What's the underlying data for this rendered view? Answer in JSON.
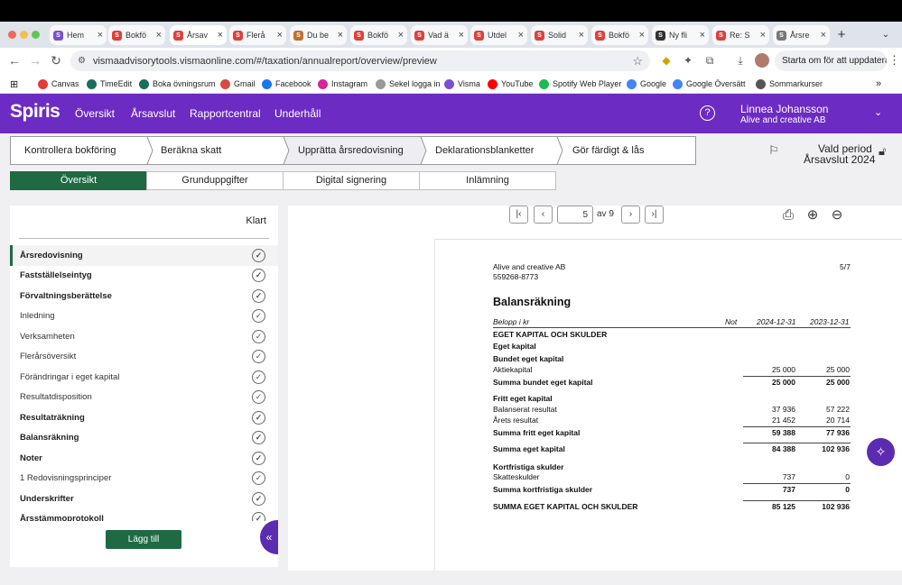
{
  "browser": {
    "tabs": [
      {
        "label": "Hem",
        "icon": "canvas-favicon",
        "color": "#7b4fd0"
      },
      {
        "label": "Bokfö",
        "icon": "spiris-favicon",
        "color": "#e0403a"
      },
      {
        "label": "Årsav",
        "icon": "spiris-favicon",
        "color": "#e0403a"
      },
      {
        "label": "Flerå",
        "icon": "spiris-favicon",
        "color": "#e0403a"
      },
      {
        "label": "Du be",
        "icon": "globe-favicon",
        "color": "#c0702f"
      },
      {
        "label": "Bokfö",
        "icon": "spiris-favicon",
        "color": "#e0403a"
      },
      {
        "label": "Vad ä",
        "icon": "spiris-favicon",
        "color": "#e0403a"
      },
      {
        "label": "Utdel",
        "icon": "spiris-favicon",
        "color": "#e0403a"
      },
      {
        "label": "Solid",
        "icon": "spiris-favicon",
        "color": "#e0403a"
      },
      {
        "label": "Bokfö",
        "icon": "spiris-favicon",
        "color": "#e0403a"
      },
      {
        "label": "Ny fli",
        "icon": "github-favicon",
        "color": "#333333"
      },
      {
        "label": "Re: S",
        "icon": "spiris-favicon",
        "color": "#e0403a"
      },
      {
        "label": "Årsre",
        "icon": "globe-favicon",
        "color": "#777777"
      }
    ],
    "url": "vismaadvisorytools.vismaonline.com/#/taxation/annualreport/overview/preview",
    "update_label": "Starta om för att uppdatera",
    "bookmarks": [
      {
        "label": "Canvas",
        "icon": "canvas-icon",
        "color": "#e23b3b"
      },
      {
        "label": "TimeEdit",
        "icon": "timeedit-icon",
        "color": "#1a6e5a"
      },
      {
        "label": "Boka övningsrum",
        "icon": "timeedit-icon",
        "color": "#1a6e5a"
      },
      {
        "label": "Gmail",
        "icon": "gmail-icon",
        "color": "#d54b3d"
      },
      {
        "label": "Facebook",
        "icon": "facebook-icon",
        "color": "#1877f2"
      },
      {
        "label": "Instagram",
        "icon": "instagram-icon",
        "color": "#d6249f"
      },
      {
        "label": "Sekel logga in",
        "icon": "sekel-icon",
        "color": "#999999"
      },
      {
        "label": "Visma",
        "icon": "visma-icon",
        "color": "#7b4fd0"
      },
      {
        "label": "YouTube",
        "icon": "youtube-icon",
        "color": "#ff0000"
      },
      {
        "label": "Spotify Web Player",
        "icon": "spotify-icon",
        "color": "#1db954"
      },
      {
        "label": "Google",
        "icon": "google-icon",
        "color": "#4285f4"
      },
      {
        "label": "Google Översätt",
        "icon": "google-icon",
        "color": "#4285f4"
      },
      {
        "label": "Sommarkurser",
        "icon": "folder-icon",
        "color": "#555555"
      }
    ]
  },
  "app": {
    "logo": "Spiris",
    "nav": [
      "Översikt",
      "Årsavslut",
      "Rapportcentral",
      "Underhåll"
    ],
    "user_name": "Linnea Johansson",
    "user_company": "Alive and creative AB",
    "accent": "#6c2bc2",
    "green": "#1f6a42"
  },
  "steps": [
    "Kontrollera bokföring",
    "Beräkna skatt",
    "Upprätta årsredovisning",
    "Deklarationsblanketter",
    "Gör färdigt & lås"
  ],
  "period": {
    "line1": "Vald period",
    "line2": "Årsavslut 2024"
  },
  "subtabs": [
    "Översikt",
    "Grunduppgifter",
    "Digital signering",
    "Inlämning"
  ],
  "left_panel": {
    "done_label": "Klart",
    "items": [
      {
        "label": "Årsredovisning",
        "bold": true,
        "selected": true
      },
      {
        "label": "Fastställelseintyg",
        "bold": true
      },
      {
        "label": "Förvaltningsberättelse",
        "bold": true
      },
      {
        "label": "Inledning",
        "bold": false
      },
      {
        "label": "Verksamheten",
        "bold": false
      },
      {
        "label": "Flerårsöversikt",
        "bold": false
      },
      {
        "label": "Förändringar i eget kapital",
        "bold": false
      },
      {
        "label": "Resultatdisposition",
        "bold": false
      },
      {
        "label": "Resultaträkning",
        "bold": true
      },
      {
        "label": "Balansräkning",
        "bold": true
      },
      {
        "label": "Noter",
        "bold": true
      },
      {
        "label": "1 Redovisningsprinciper",
        "bold": false
      },
      {
        "label": "Underskrifter",
        "bold": true
      },
      {
        "label": "Årsstämmoprotokoll",
        "bold": true
      }
    ],
    "add_label": "Lägg till"
  },
  "viewer": {
    "page_current": "5",
    "page_of": "av",
    "page_total": "9"
  },
  "document": {
    "company": "Alive and creative AB",
    "org_nr": "559268-8773",
    "page_no": "5/7",
    "title": "Balansräkning",
    "col_amount": "Belopp i kr",
    "col_note": "Not",
    "col_y1": "2024-12-31",
    "col_y2": "2023-12-31",
    "rows": [
      {
        "label": "EGET KAPITAL OCH SKULDER",
        "v1": "",
        "v2": "",
        "bold": true
      },
      {
        "label": "Eget kapital",
        "v1": "",
        "v2": "",
        "bold": true
      },
      {
        "label": "Bundet eget kapital",
        "v1": "",
        "v2": "",
        "bold": true
      },
      {
        "label": "Aktiekapital",
        "v1": "25 000",
        "v2": "25 000",
        "bold": false
      },
      {
        "label": "Summa bundet eget kapital",
        "v1": "25 000",
        "v2": "25 000",
        "bold": true
      },
      {
        "label": "Fritt eget kapital",
        "v1": "",
        "v2": "",
        "bold": true
      },
      {
        "label": "Balanserat resultat",
        "v1": "37 936",
        "v2": "57 222",
        "bold": false
      },
      {
        "label": "Årets resultat",
        "v1": "21 452",
        "v2": "20 714",
        "bold": false
      },
      {
        "label": "Summa fritt eget kapital",
        "v1": "59 388",
        "v2": "77 936",
        "bold": true
      },
      {
        "label": "Summa eget kapital",
        "v1": "84 388",
        "v2": "102 936",
        "bold": true
      },
      {
        "label": "Kortfristiga skulder",
        "v1": "",
        "v2": "",
        "bold": true
      },
      {
        "label": "Skatteskulder",
        "v1": "737",
        "v2": "0",
        "bold": false
      },
      {
        "label": "Summa kortfristiga skulder",
        "v1": "737",
        "v2": "0",
        "bold": true
      },
      {
        "label": "SUMMA EGET KAPITAL OCH SKULDER",
        "v1": "85 125",
        "v2": "102 936",
        "bold": true
      }
    ]
  }
}
